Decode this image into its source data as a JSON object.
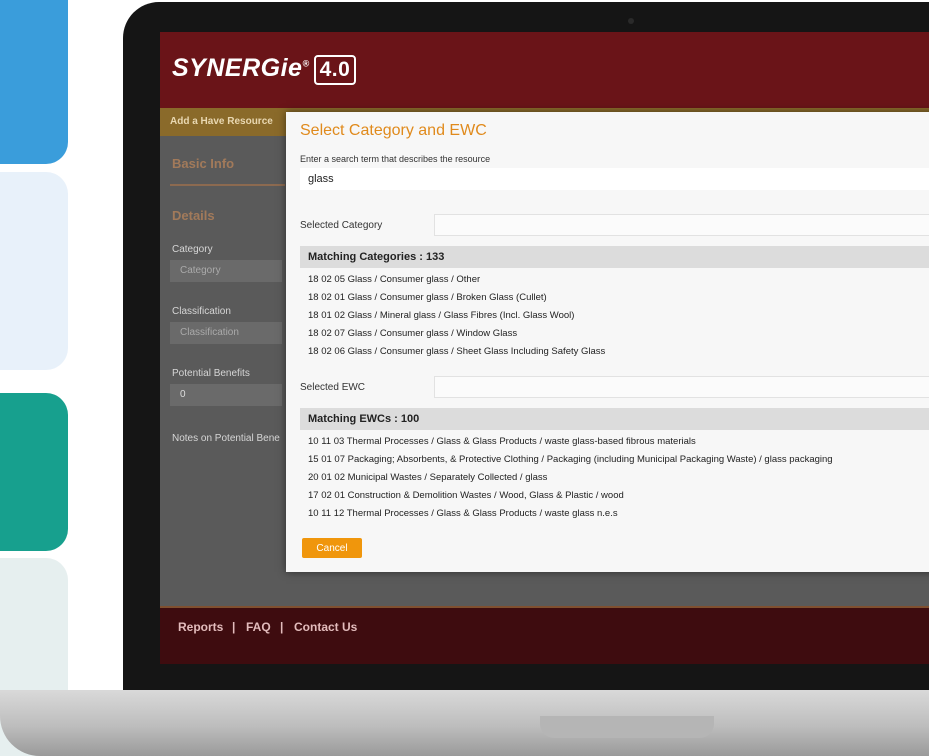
{
  "app": {
    "logo_name": "SYNERGie",
    "logo_reg": "®",
    "logo_version": "4.0",
    "subbar_label": "Add a Have Resource"
  },
  "form": {
    "basic_info": "Basic Info",
    "details": "Details",
    "category_label": "Category",
    "category_placeholder": "Category",
    "classification_label": "Classification",
    "classification_placeholder": "Classification",
    "potential_benefits_label": "Potential Benefits",
    "potential_benefits_value": "0",
    "notes_label": "Notes on Potential Bene"
  },
  "footer": {
    "links": [
      "Reports",
      "FAQ",
      "Contact Us"
    ],
    "separator": "|"
  },
  "modal": {
    "title": "Select Category and EWC",
    "search_hint": "Enter a search term that describes the resource",
    "search_value": "glass",
    "selected_category_label": "Selected Category",
    "matching_categories_header": "Matching Categories : 133",
    "categories": [
      "18 02 05  Glass / Consumer glass / Other",
      "18 02 01  Glass / Consumer glass / Broken Glass (Cullet)",
      "18 01 02  Glass / Mineral glass / Glass Fibres (Incl. Glass Wool)",
      "18 02 07  Glass / Consumer glass / Window Glass",
      "18 02 06  Glass / Consumer glass / Sheet Glass Including Safety Glass"
    ],
    "selected_ewc_label": "Selected EWC",
    "matching_ewcs_header": "Matching EWCs : 100",
    "ewcs": [
      "10 11 03  Thermal Processes / Glass & Glass Products /  waste glass-based fibrous materials",
      "15 01 07  Packaging; Absorbents, & Protective Clothing / Packaging (including Municipal Packaging Waste) /  glass packaging",
      "20 01 02  Municipal Wastes / Separately Collected /  glass",
      "17 02 01  Construction & Demolition Wastes   / Wood, Glass & Plastic /  wood",
      "10 11 12  Thermal Processes / Glass & Glass Products /  waste glass n.e.s"
    ],
    "cancel_label": "Cancel"
  }
}
